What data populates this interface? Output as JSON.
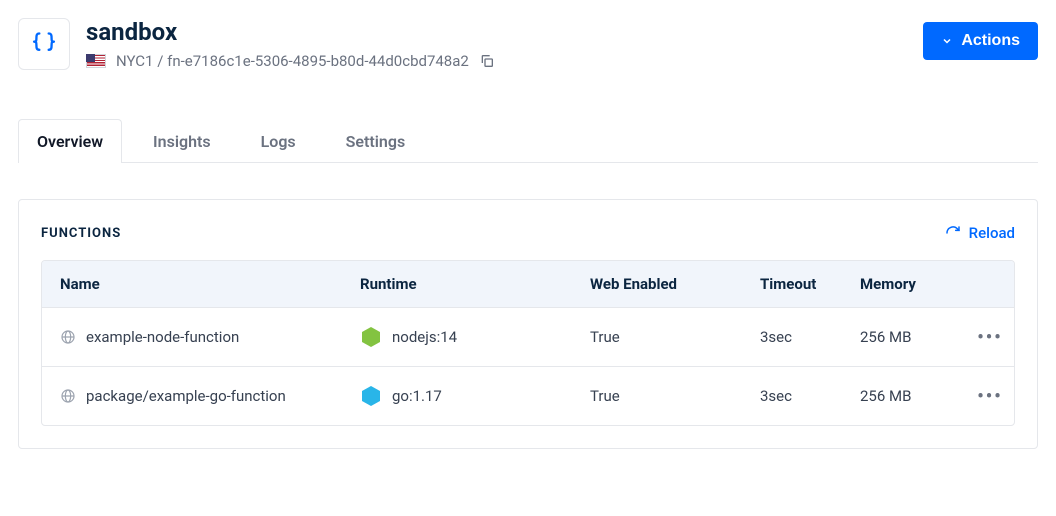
{
  "header": {
    "title": "sandbox",
    "region": "NYC1",
    "separator": " / ",
    "resource_id": "fn-e7186c1e-5306-4895-b80d-44d0cbd748a2",
    "actions_label": "Actions"
  },
  "tabs": [
    {
      "label": "Overview",
      "active": true
    },
    {
      "label": "Insights",
      "active": false
    },
    {
      "label": "Logs",
      "active": false
    },
    {
      "label": "Settings",
      "active": false
    }
  ],
  "functions": {
    "section_title": "FUNCTIONS",
    "reload_label": "Reload",
    "columns": {
      "name": "Name",
      "runtime": "Runtime",
      "web_enabled": "Web Enabled",
      "timeout": "Timeout",
      "memory": "Memory"
    },
    "rows": [
      {
        "name": "example-node-function",
        "runtime": "nodejs:14",
        "runtime_icon": "node",
        "web_enabled": "True",
        "timeout": "3sec",
        "memory": "256 MB"
      },
      {
        "name": "package/example-go-function",
        "runtime": "go:1.17",
        "runtime_icon": "go",
        "web_enabled": "True",
        "timeout": "3sec",
        "memory": "256 MB"
      }
    ]
  }
}
